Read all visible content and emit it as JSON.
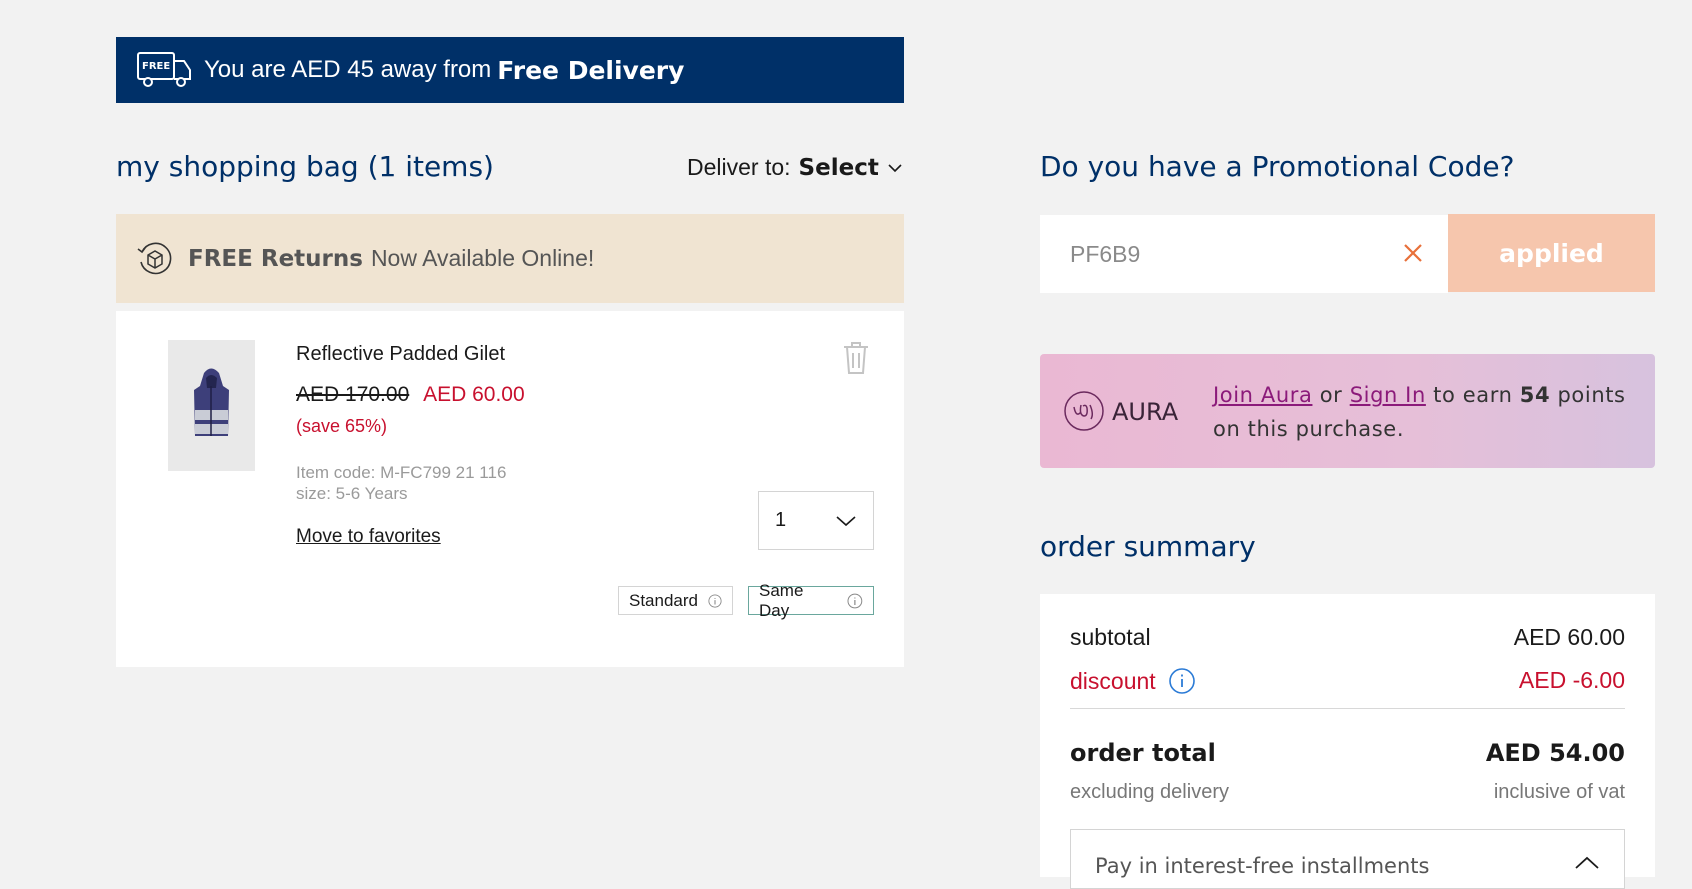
{
  "banner": {
    "message": "You are AED 45 away from",
    "highlight": "Free Delivery",
    "icon": "free-delivery-truck-icon",
    "icon_text": "FREE",
    "color": "#003068"
  },
  "bag": {
    "title": "my shopping bag (1 items)",
    "deliver_label": "Deliver to:",
    "deliver_value": "Select"
  },
  "returns": {
    "strong": "FREE Returns",
    "text": "Now Available Online!",
    "bg": "#f0e4d2"
  },
  "item": {
    "name": "Reflective Padded Gilet",
    "old_price": "AED  170.00",
    "new_price": "AED  60.00",
    "save": "(save 65%)",
    "item_code": "Item code: M-FC799 21 116",
    "size": "size: 5-6 Years",
    "move_to_favorites": "Move to favorites",
    "quantity": "1",
    "delivery_options": [
      "Standard",
      "Same Day"
    ]
  },
  "promo": {
    "title": "Do you have a Promotional Code?",
    "code": "PF6B9",
    "button": "applied"
  },
  "aura": {
    "name": "AURA",
    "join": "Join Aura",
    "or": "or",
    "sign_in": "Sign In",
    "earn_pre": "to earn",
    "points": "54",
    "earn_post": "points on this purchase."
  },
  "summary": {
    "title": "order summary",
    "subtotal_label": "subtotal",
    "subtotal_value": "AED 60.00",
    "discount_label": "discount",
    "discount_value": "AED -6.00",
    "total_label": "order total",
    "total_value": "AED 54.00",
    "excluding": "excluding delivery",
    "inclusive": "inclusive of vat",
    "installments": "Pay in interest-free installments"
  },
  "colors": {
    "navy": "#003068",
    "sale_red": "#c8102e",
    "applied_peach": "#f6c6ad",
    "aura_pink": "#eab8d3"
  }
}
